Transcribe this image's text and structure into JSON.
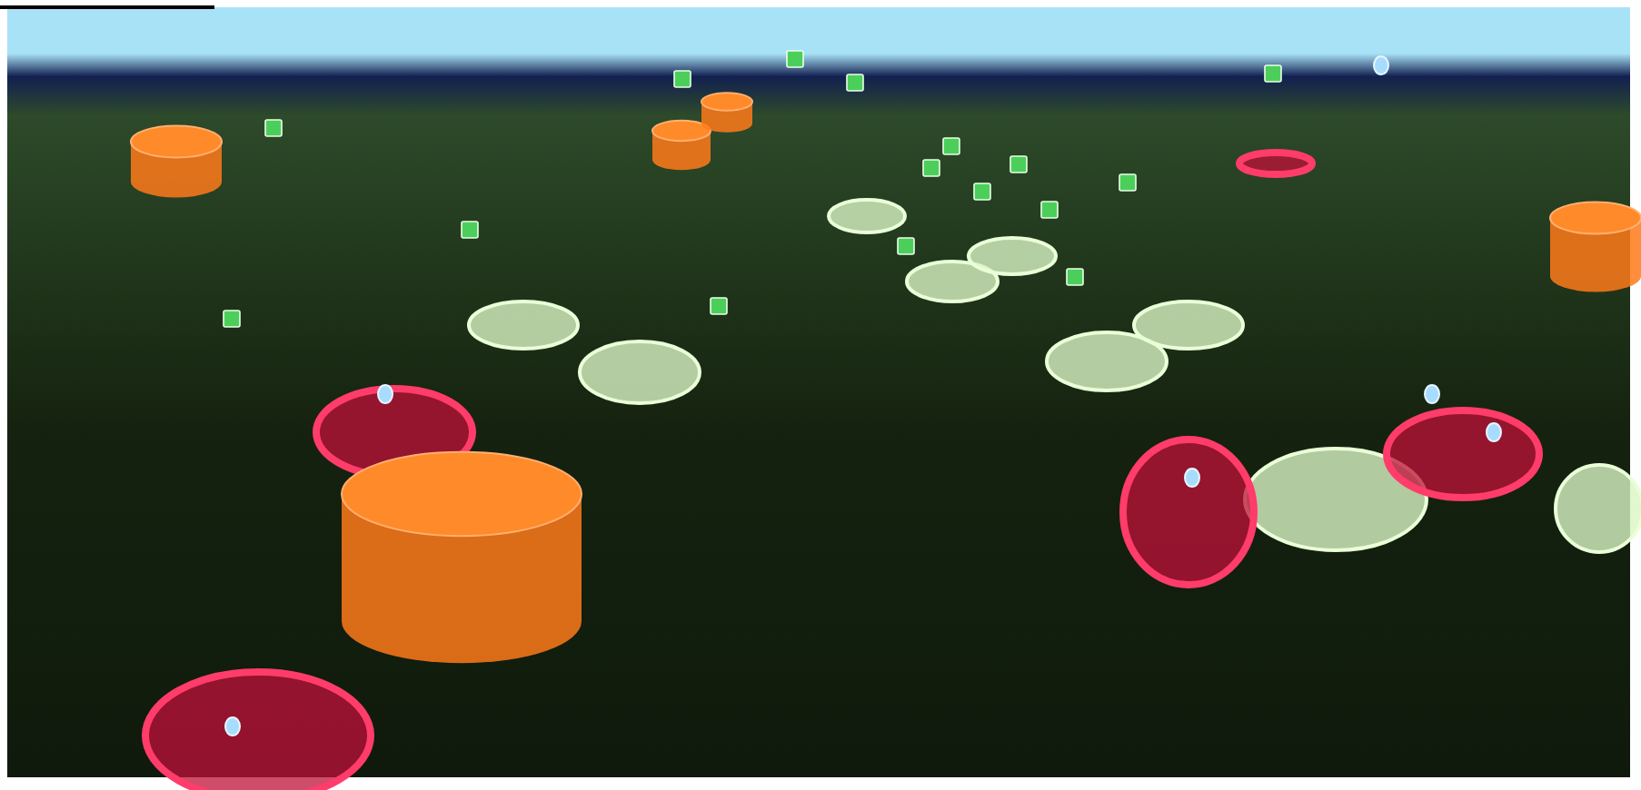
{
  "overlays": [
    {
      "kind": "zone"
    },
    {
      "kind": "zone"
    },
    {
      "kind": "zone"
    },
    {
      "kind": "zone"
    },
    {
      "kind": "zone"
    },
    {
      "kind": "zone"
    },
    {
      "kind": "zone"
    },
    {
      "kind": "zone"
    },
    {
      "kind": "zone"
    },
    {
      "kind": "alert"
    },
    {
      "kind": "alert"
    },
    {
      "kind": "alert"
    },
    {
      "kind": "alert"
    },
    {
      "kind": "alert"
    },
    {
      "kind": "cylinder"
    },
    {
      "kind": "cylinder"
    },
    {
      "kind": "cylinder"
    },
    {
      "kind": "cylinder"
    },
    {
      "kind": "cylinder"
    },
    {
      "kind": "station"
    },
    {
      "kind": "station"
    },
    {
      "kind": "station"
    },
    {
      "kind": "station"
    },
    {
      "kind": "station"
    },
    {
      "kind": "station"
    },
    {
      "kind": "station"
    },
    {
      "kind": "station"
    },
    {
      "kind": "station"
    },
    {
      "kind": "station"
    },
    {
      "kind": "station"
    },
    {
      "kind": "station"
    },
    {
      "kind": "station"
    },
    {
      "kind": "station"
    },
    {
      "kind": "station"
    },
    {
      "kind": "station"
    },
    {
      "kind": "pin"
    },
    {
      "kind": "pin"
    },
    {
      "kind": "pin"
    },
    {
      "kind": "pin"
    },
    {
      "kind": "pin"
    },
    {
      "kind": "pin"
    }
  ]
}
